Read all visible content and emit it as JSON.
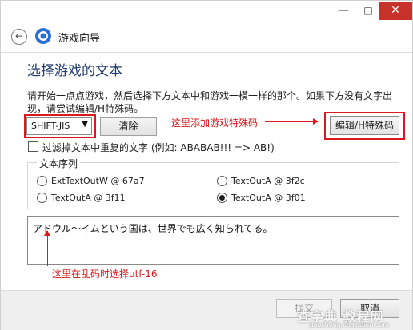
{
  "window": {
    "minimize": "—",
    "maximize": "□",
    "close": "✕",
    "header_title": "游戏向导",
    "back_icon": "back-arrow-icon"
  },
  "page": {
    "title": "选择游戏的文本",
    "instructions": "请开始一点点游戏，然后选择下方文本中和游戏一模一样的那个。如果下方没有文字出现，请尝试编辑/H特殊码。"
  },
  "controls": {
    "encoding_value": "SHIFT-JIS",
    "clear_label": "清除",
    "edit_label": "编辑/H特殊码",
    "filter_label": "过滤掉文本中重复的文字 (例如: ABABAB!!! => AB!)",
    "filter_checked": false
  },
  "text_sequence": {
    "label": "文本序列",
    "options": [
      {
        "label": "ExtTextOutW @ 67a7",
        "checked": false
      },
      {
        "label": "TextOutA @ 3f2c",
        "checked": false
      },
      {
        "label": "TextOutA @ 3f11",
        "checked": false
      },
      {
        "label": "TextOutA @ 3f01",
        "checked": true
      }
    ]
  },
  "preview_text": "アドウル～イムという国は、世界でも広く知られてる。",
  "annotations": {
    "special_code": "这里添加游戏特殊码",
    "utf16": "这里在乱码时选择utf-16",
    "color": "#d9191b"
  },
  "footer": {
    "submit_label": "提交",
    "cancel_label": "取消",
    "watermark": "查字典 教程网",
    "watermark_sub": "jiaocheng.chazidian.com"
  }
}
